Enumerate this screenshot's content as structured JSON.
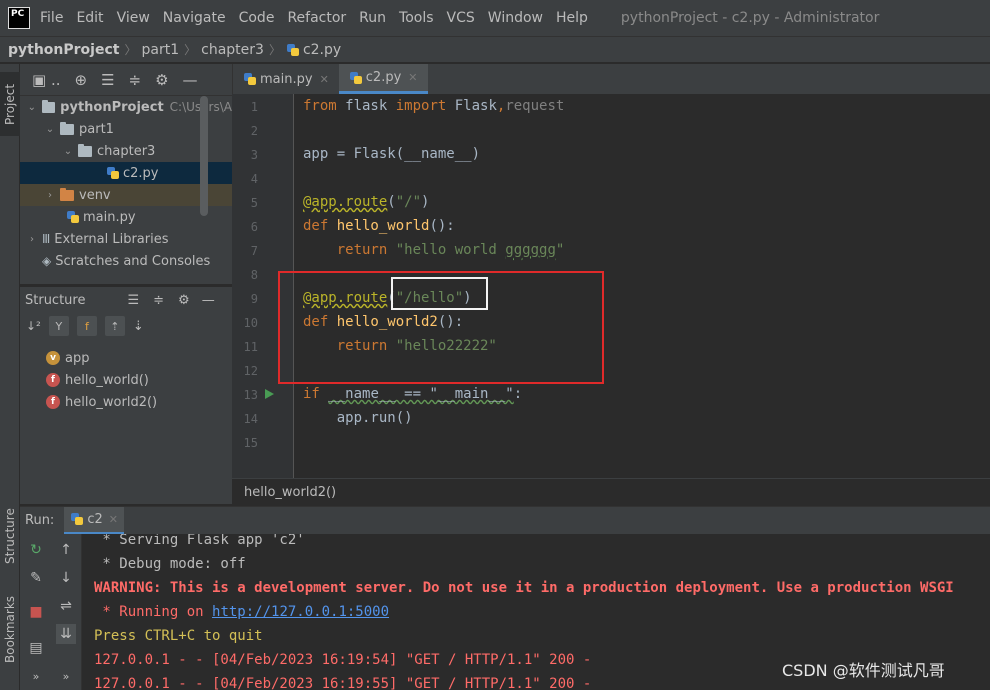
{
  "app": {
    "logo": "PC",
    "window_title": "pythonProject - c2.py - Administrator"
  },
  "menu": [
    "File",
    "Edit",
    "View",
    "Navigate",
    "Code",
    "Refactor",
    "Run",
    "Tools",
    "VCS",
    "Window",
    "Help"
  ],
  "breadcrumb": [
    "pythonProject",
    "part1",
    "chapter3",
    "c2.py"
  ],
  "side_tabs": {
    "project": "Project",
    "structure": "Structure",
    "bookmarks": "Bookmarks"
  },
  "project_tree": {
    "root": "pythonProject",
    "root_hint": "C:\\Users\\A",
    "part1": "part1",
    "chapter3": "chapter3",
    "c2": "c2.py",
    "venv": "venv",
    "main": "main.py",
    "external": "External Libraries",
    "scratches": "Scratches and Consoles"
  },
  "structure": {
    "title": "Structure",
    "items": [
      "app",
      "hello_world()",
      "hello_world2()"
    ]
  },
  "tabs": [
    "main.py",
    "c2.py"
  ],
  "code": {
    "line_numbers": [
      "1",
      "2",
      "3",
      "4",
      "5",
      "6",
      "7",
      "8",
      "9",
      "10",
      "11",
      "12",
      "13",
      "14",
      "15"
    ],
    "l1_a": "from",
    "l1_b": " flask ",
    "l1_c": "import",
    "l1_d": " Flask",
    "l1_e": ",",
    "l1_f": "request",
    "l3": "app = Flask(__name__)",
    "l5_a": "@app.route",
    "l5_b": "(",
    "l5_c": "\"/\"",
    "l5_d": ")",
    "l6_a": "def ",
    "l6_b": "hello_world",
    "l6_c": "():",
    "l7_a": "    return ",
    "l7_b": "\"hello world ",
    "l7_c": "gggggg",
    "l7_d": "\"",
    "l9_a": "@app.route",
    "l9_b": "(",
    "l9_c": "\"/hello\"",
    "l9_d": ")",
    "l10_a": "def ",
    "l10_b": "hello_world2",
    "l10_c": "():",
    "l11_a": "    return ",
    "l11_b": "\"hello22222\"",
    "l13_a": "if ",
    "l13_b": "__name__ == \"__main__\"",
    "l13_c": ":",
    "l14": "    app.run()"
  },
  "editor_breadcrumb": "hello_world2()",
  "run": {
    "label": "Run:",
    "tab": "c2",
    "lines": {
      "a": " * Serving Flask app 'c2'",
      "b": " * Debug mode: off",
      "c": "WARNING: This is a development server. Do not use it in a production deployment. Use a production WSGI",
      "d": " * Running on ",
      "d_link": "http://127.0.0.1:5000",
      "e": "Press CTRL+C to quit",
      "f": "127.0.0.1 - - [04/Feb/2023 16:19:54] \"GET / HTTP/1.1\" 200 -",
      "g": "127.0.0.1 - - [04/Feb/2023 16:19:55] \"GET / HTTP/1.1\" 200 -"
    }
  },
  "watermark": "CSDN @软件测试凡哥"
}
